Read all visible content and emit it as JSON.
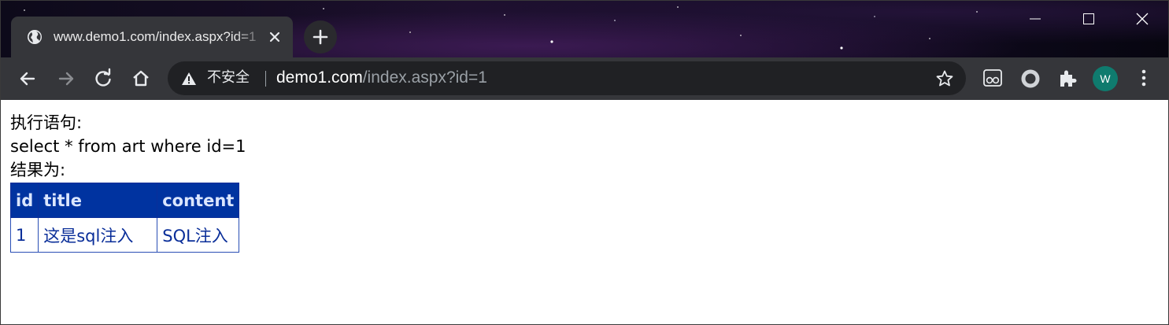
{
  "browser": {
    "tab": {
      "title": "www.demo1.com/index.aspx?id=1",
      "favicon": "globe-icon",
      "close": "close-icon"
    },
    "new_tab": "plus-icon",
    "window_controls": [
      "minimize-icon",
      "maximize-icon",
      "close-icon"
    ],
    "address_bar": {
      "security_label": "不安全",
      "host": "demo1.com",
      "path": "/index.aspx?id=1"
    },
    "profile_initial": "W",
    "colors": {
      "frame": "#35363a",
      "omnibox": "#202124",
      "avatar": "#0f7b6e"
    }
  },
  "page": {
    "statement_label": "执行语句:",
    "sql": "select * from art where id=1",
    "result_label": "结果为:",
    "table": {
      "headers": [
        "id",
        "title",
        "content"
      ],
      "rows": [
        [
          "1",
          "这是sql注入",
          "SQL注入"
        ]
      ],
      "header_bg": "#0033a0",
      "cell_text_color": "#0a2e99"
    }
  }
}
